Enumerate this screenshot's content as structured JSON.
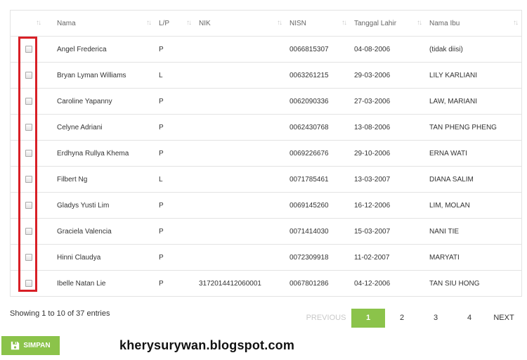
{
  "table": {
    "headers": [
      "",
      "Nama",
      "L/P",
      "NIK",
      "NISN",
      "Tanggal Lahir",
      "Nama Ibu"
    ],
    "rows": [
      {
        "nama": "Angel Frederica",
        "lp": "P",
        "nik": "",
        "nisn": "0066815307",
        "tgl": "04-08-2006",
        "ibu": "(tidak diisi)"
      },
      {
        "nama": "Bryan Lyman Williams",
        "lp": "L",
        "nik": "",
        "nisn": "0063261215",
        "tgl": "29-03-2006",
        "ibu": "LILY KARLIANI"
      },
      {
        "nama": "Caroline Yapanny",
        "lp": "P",
        "nik": "",
        "nisn": "0062090336",
        "tgl": "27-03-2006",
        "ibu": "LAW, MARIANI"
      },
      {
        "nama": "Celyne Adriani",
        "lp": "P",
        "nik": "",
        "nisn": "0062430768",
        "tgl": "13-08-2006",
        "ibu": "TAN PHENG PHENG"
      },
      {
        "nama": "Erdhyna Rullya Khema",
        "lp": "P",
        "nik": "",
        "nisn": "0069226676",
        "tgl": "29-10-2006",
        "ibu": "ERNA WATI"
      },
      {
        "nama": "Filbert Ng",
        "lp": "L",
        "nik": "",
        "nisn": "0071785461",
        "tgl": "13-03-2007",
        "ibu": "DIANA SALIM"
      },
      {
        "nama": "Gladys Yusti Lim",
        "lp": "P",
        "nik": "",
        "nisn": "0069145260",
        "tgl": "16-12-2006",
        "ibu": "LIM, MOLAN"
      },
      {
        "nama": "Graciela Valencia",
        "lp": "P",
        "nik": "",
        "nisn": "0071414030",
        "tgl": "15-03-2007",
        "ibu": "NANI TIE"
      },
      {
        "nama": "Hinni Claudya",
        "lp": "P",
        "nik": "",
        "nisn": "0072309918",
        "tgl": "11-02-2007",
        "ibu": "MARYATI"
      },
      {
        "nama": "Ibelle Natan Lie",
        "lp": "P",
        "nik": "3172014412060001",
        "nisn": "0067801286",
        "tgl": "04-12-2006",
        "ibu": "TAN SIU HONG"
      }
    ]
  },
  "info": "Showing 1 to 10 of 37 entries",
  "pagination": {
    "previous": "PREVIOUS",
    "pages": [
      "1",
      "2",
      "3",
      "4"
    ],
    "active": "1",
    "next": "NEXT"
  },
  "save_button": {
    "label": "SIMPAN",
    "icon": "floppy-disk-icon"
  },
  "watermark": "kherysurywan.blogspot.com",
  "colors": {
    "accent": "#8bc34a",
    "highlight": "#d81f26"
  }
}
